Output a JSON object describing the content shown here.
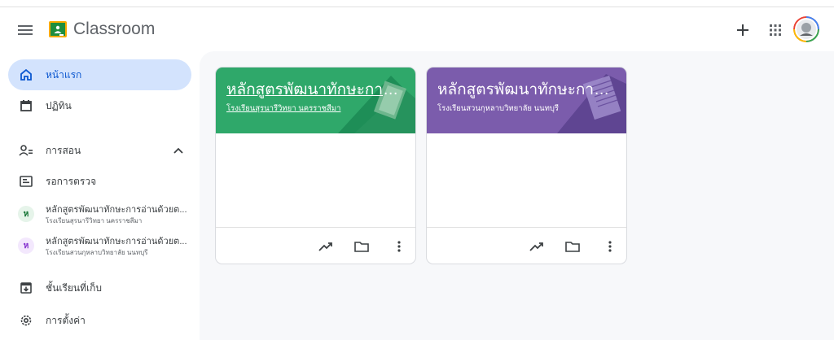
{
  "header": {
    "app_title": "Classroom"
  },
  "sidebar": {
    "home": "หน้าแรก",
    "calendar": "ปฏิทิน",
    "teaching": "การสอน",
    "to_review": "รอการตรวจ",
    "classes": [
      {
        "badge": "ห",
        "name": "หลักสูตรพัฒนาทักษะการอ่านด้วยต...",
        "school": "โรงเรียนสุรนารีวิทยา นครราชสีมา",
        "badge_bg": "#e6f4ea",
        "badge_fg": "#137333"
      },
      {
        "badge": "ห",
        "name": "หลักสูตรพัฒนาทักษะการอ่านด้วยต...",
        "school": "โรงเรียนสวนกุหลาบวิทยาลัย นนทบุรี",
        "badge_bg": "#f3e8fd",
        "badge_fg": "#8430ce"
      }
    ],
    "archived": "ชั้นเรียนที่เก็บ",
    "settings": "การตั้งค่า"
  },
  "cards": [
    {
      "title": "หลักสูตรพัฒนาทักษะการอ่...",
      "school": "โรงเรียนสุรนารีวิทยา นครราชสีมา",
      "color": "#2fa86a"
    },
    {
      "title": "หลักสูตรพัฒนาทักษะการอ่...",
      "school": "โรงเรียนสวนกุหลาบวิทยาลัย นนทบุรี",
      "color": "#7b5cac"
    }
  ],
  "icons": {
    "menu": "menu-icon",
    "add": "plus-icon",
    "apps": "apps-grid-icon",
    "home": "home-icon",
    "calendar": "calendar-icon",
    "teaching": "people-icon",
    "review": "review-icon",
    "archive": "archive-icon",
    "settings": "gear-icon",
    "trend": "trending-up-icon",
    "folder": "folder-icon",
    "more": "more-vert-icon"
  }
}
